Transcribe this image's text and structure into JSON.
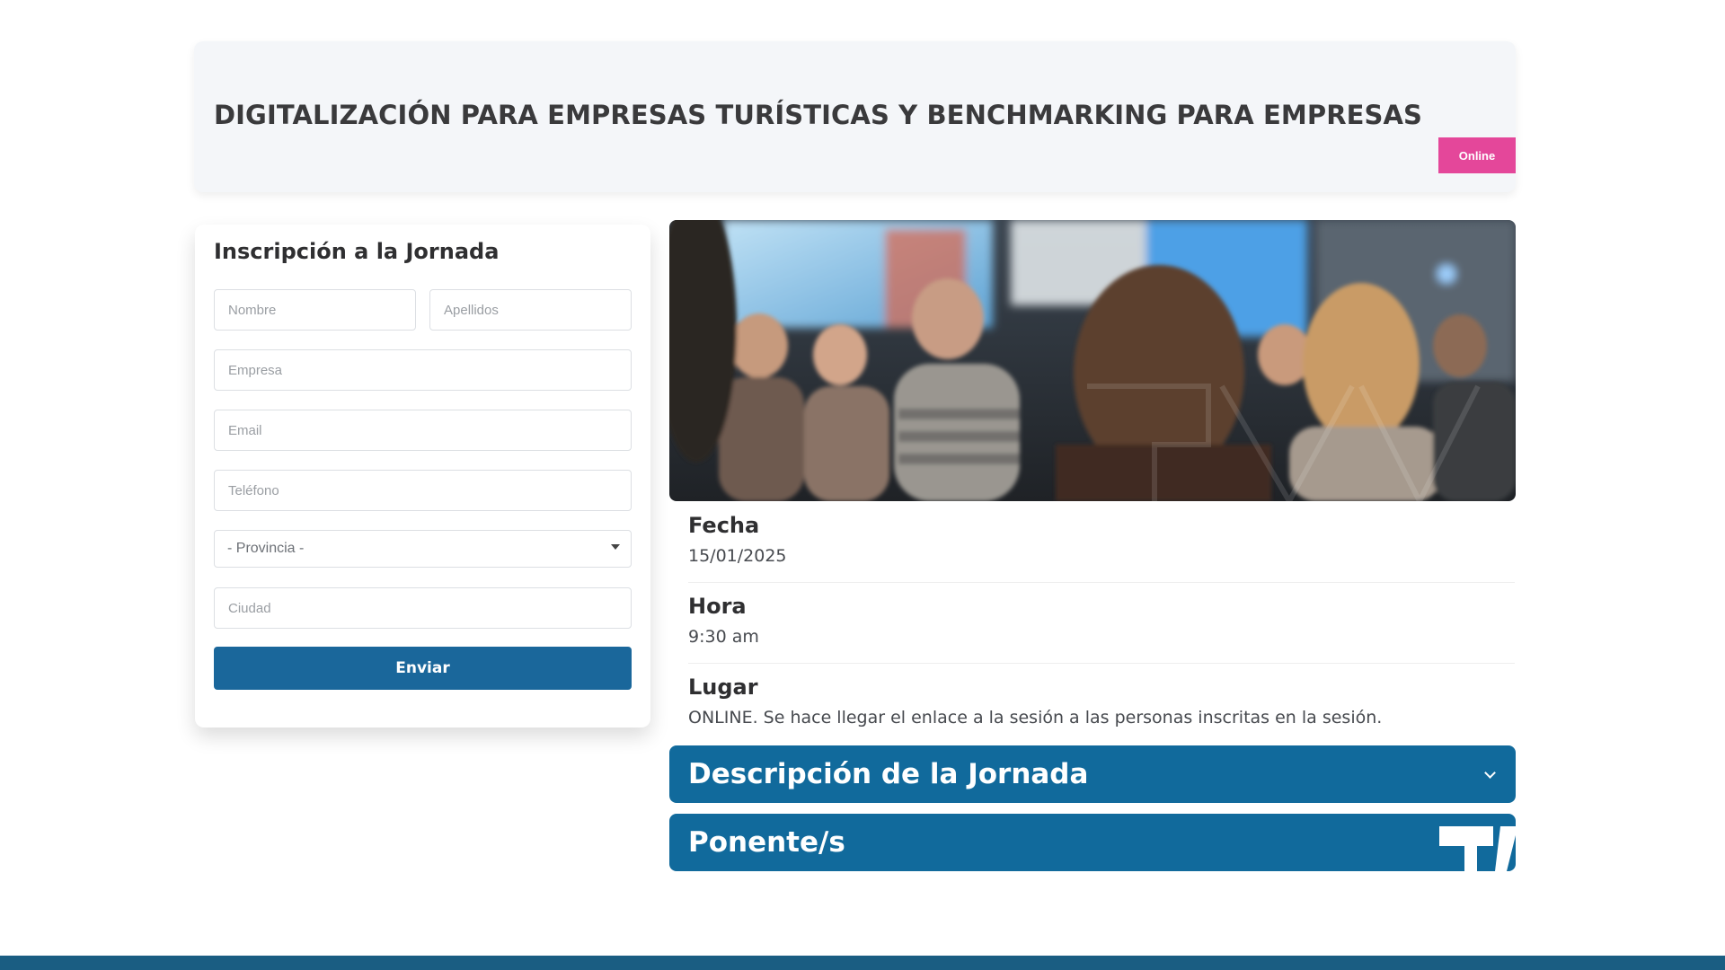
{
  "header": {
    "title": "DIGITALIZACIÓN PARA EMPRESAS TURÍSTICAS Y BENCHMARKING PARA EMPRESAS",
    "badge": "Online",
    "badge_color": "#e4479a"
  },
  "form": {
    "title": "Inscripción a la Jornada",
    "fields": {
      "nombre": "Nombre",
      "apellidos": "Apellidos",
      "empresa": "Empresa",
      "email": "Email",
      "telefono": "Teléfono",
      "provincia": "- Provincia -",
      "ciudad": "Ciudad"
    },
    "submit_label": "Enviar",
    "accent_color": "#1a679b"
  },
  "details": {
    "fecha_label": "Fecha",
    "fecha_value": "15/01/2025",
    "hora_label": "Hora",
    "hora_value": "9:30 am",
    "lugar_label": "Lugar",
    "lugar_value": "ONLINE. Se hace llegar el enlace a la sesión a las personas inscritas en la sesión."
  },
  "accordions": {
    "descripcion": "Descripción de la Jornada",
    "ponentes": "Ponente/s"
  },
  "icons": {
    "provincia": "chevron-down-icon",
    "descripcion": "chevron-down-icon"
  }
}
